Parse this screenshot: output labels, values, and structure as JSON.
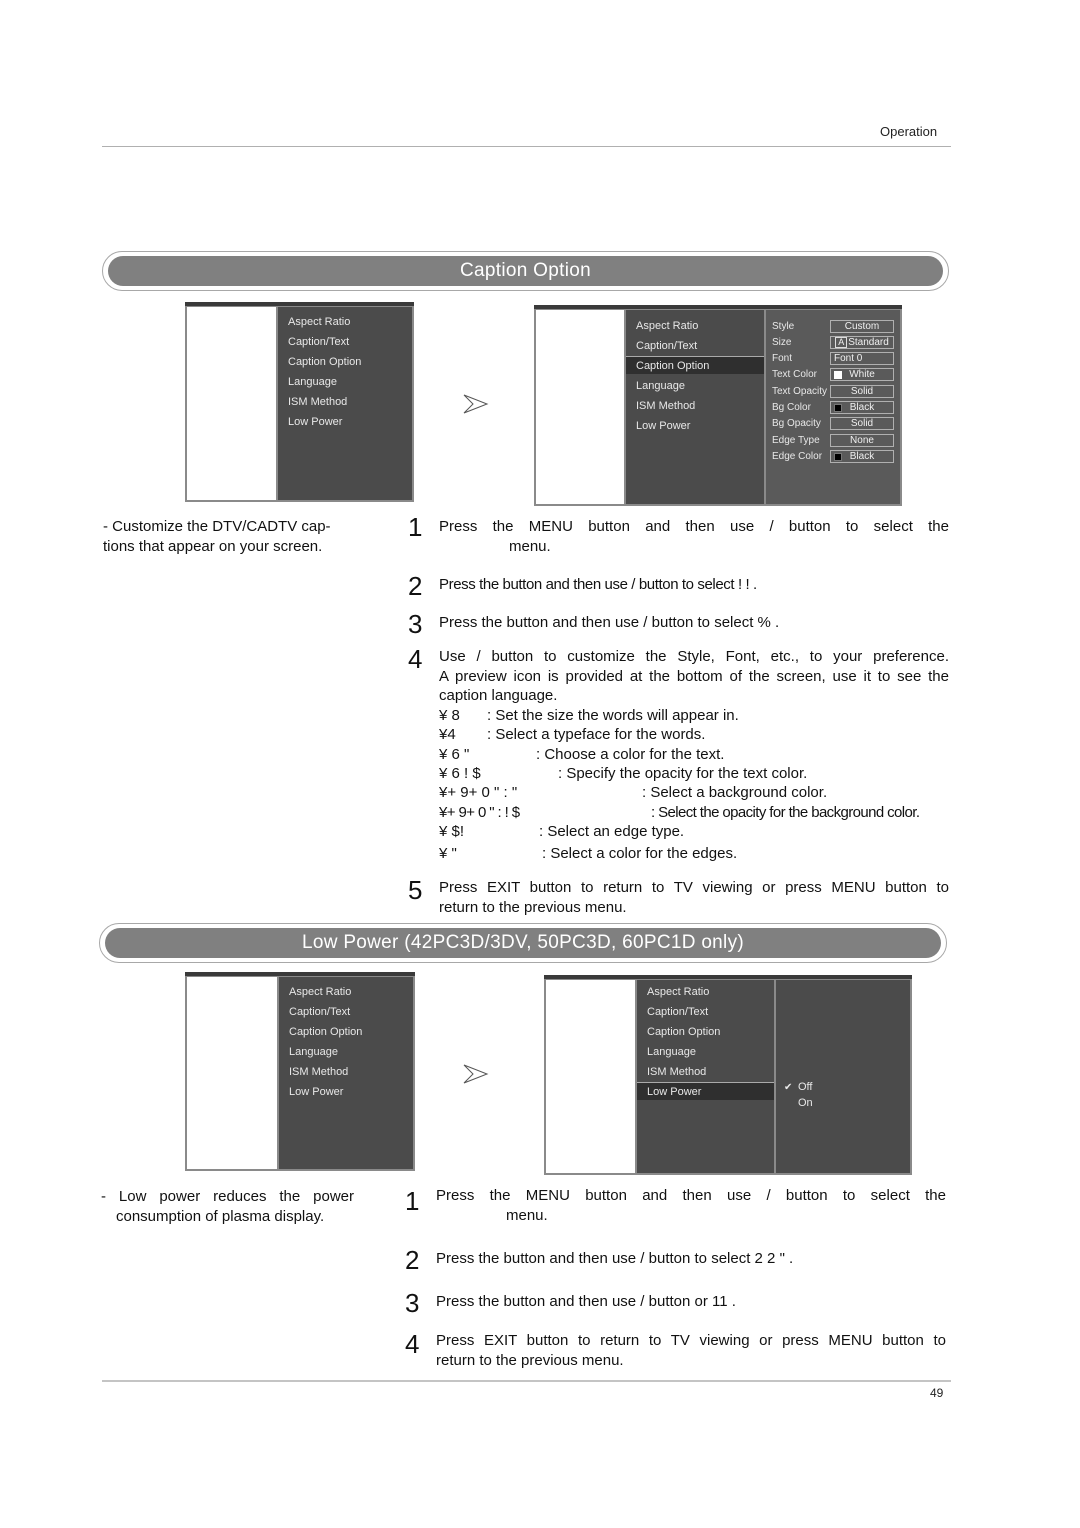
{
  "header": {
    "section": "Operation"
  },
  "page_number": "49",
  "caption_option": {
    "title": "Caption Option",
    "description": "- Customize the DTV/CADTV cap-\ntions that appear on your screen.",
    "osd_before": {
      "menu": [
        "Aspect Ratio",
        "Caption/Text",
        "Caption Option",
        "Language",
        "ISM Method",
        "Low Power"
      ]
    },
    "osd_after": {
      "menu": [
        "Aspect Ratio",
        "Caption/Text",
        "Caption Option",
        "Language",
        "ISM Method",
        "Low Power"
      ],
      "selected": "Caption Option",
      "options": [
        {
          "label": "Style",
          "value": "Custom",
          "swatch": ""
        },
        {
          "label": "Size",
          "value": "Standard",
          "swatch": "glyph-A"
        },
        {
          "label": "Font",
          "value": "Font  0",
          "swatch": ""
        },
        {
          "label": "Text Color",
          "value": "White",
          "swatch": "white"
        },
        {
          "label": "Text Opacity",
          "value": "Solid",
          "swatch": ""
        },
        {
          "label": "Bg Color",
          "value": "Black",
          "swatch": "black"
        },
        {
          "label": "Bg Opacity",
          "value": "Solid",
          "swatch": ""
        },
        {
          "label": "Edge Type",
          "value": "None",
          "swatch": ""
        },
        {
          "label": "Edge Color",
          "value": "Black",
          "swatch": "black"
        }
      ]
    },
    "steps": [
      {
        "num": "1",
        "line1": "Press the MENU button and then use      /       button to select the",
        "line2": "menu."
      },
      {
        "num": "2",
        "line1": "Press the     button and then use    /    button to select  !    !                  ."
      },
      {
        "num": "3",
        "line1": "Press the     button and then use     /     button to select     %       ."
      },
      {
        "num": "4",
        "line1": "Use     /     button to customize the Style, Font, etc., to your preference.",
        "line2": "A preview icon is provided at the bottom of the screen, use it to see the",
        "line3": "caption language.",
        "items": [
          {
            "code": "¥  8",
            "text": ": Set the size the words will appear in."
          },
          {
            "code": "¥4",
            "text": ": Select a typeface for the words."
          },
          {
            "code": "¥  6     \"",
            "text": ": Choose a color for the text."
          },
          {
            "code": "¥  6   !   $",
            "text": ": Specify the opacity for the text color."
          },
          {
            "code": "¥+  9+  0 \"   :     \"",
            "text": ": Select a background color."
          },
          {
            "code": "¥+  9+  0 \"   : !   $",
            "text": ": Select the opacity for the background color."
          },
          {
            "code": "¥      $!",
            "text": ": Select an edge type."
          },
          {
            "code": "¥          \"",
            "text": ": Select a color for the edges."
          }
        ]
      },
      {
        "num": "5",
        "line1": "Press EXIT button to return to TV viewing or press MENU button to",
        "line2": "return to the previous menu."
      }
    ]
  },
  "low_power": {
    "title": "Low Power (42PC3D/3DV, 50PC3D, 60PC1D only)",
    "description_line1": "- Low  power  reduces  the  power",
    "description_line2": "consumption of plasma display.",
    "osd_before": {
      "menu": [
        "Aspect Ratio",
        "Caption/Text",
        "Caption Option",
        "Language",
        "ISM Method",
        "Low Power"
      ]
    },
    "osd_after": {
      "menu": [
        "Aspect Ratio",
        "Caption/Text",
        "Caption Option",
        "Language",
        "ISM Method",
        "Low Power"
      ],
      "selected": "Low Power",
      "options": [
        {
          "label": "Off",
          "checked": true,
          "check_glyph": "✔"
        },
        {
          "label": "On",
          "checked": false
        }
      ]
    },
    "steps": [
      {
        "num": "1",
        "line1": "Press the MENU button and then use      /       button to select the",
        "line2": "menu."
      },
      {
        "num": "2",
        "line1": "Press the     button and then use     /     button to select  2  2 \"         ."
      },
      {
        "num": "3",
        "line1": "Press the     button and then use     /     button       or  11 ."
      },
      {
        "num": "4",
        "line1": "Press EXIT button to return to TV viewing or press MENU button to",
        "line2": "return to the previous menu."
      }
    ]
  }
}
